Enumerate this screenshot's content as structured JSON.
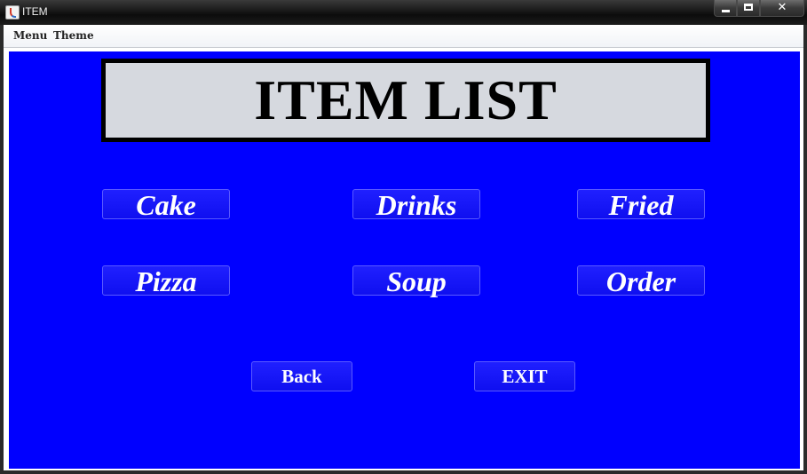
{
  "window": {
    "title": "ITEM",
    "close_glyph": "✕"
  },
  "menubar": {
    "items": [
      {
        "label": "Menu"
      },
      {
        "label": "Theme"
      }
    ]
  },
  "main": {
    "title": "ITEM LIST",
    "items": [
      {
        "label": "Cake"
      },
      {
        "label": "Drinks"
      },
      {
        "label": "Fried"
      },
      {
        "label": "Pizza"
      },
      {
        "label": "Soup"
      },
      {
        "label": "Order"
      }
    ],
    "back_label": "Back",
    "exit_label": "EXIT"
  },
  "colors": {
    "panel_background": "#0000ff",
    "title_background": "#d6d9df",
    "button_text": "#ffffff"
  },
  "icons": {
    "app": "java-coffee-icon",
    "minimize": "minimize-icon",
    "maximize": "maximize-icon",
    "close": "close-icon"
  }
}
